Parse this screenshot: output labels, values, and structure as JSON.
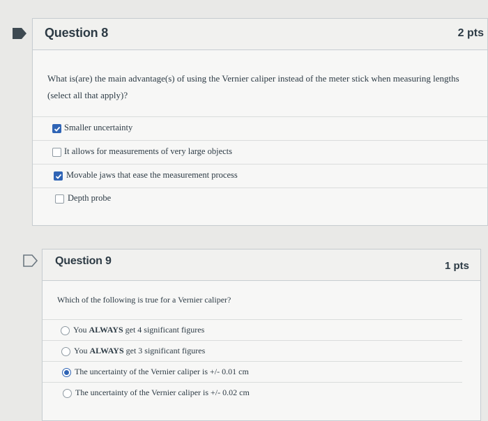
{
  "question8": {
    "title": "Question 8",
    "points": "2 pts",
    "text": "What is(are) the main advantage(s) of using the Vernier caliper instead of the meter stick when measuring lengths (select all that apply)?",
    "answers": [
      {
        "label": "Smaller uncertainty",
        "checked": true
      },
      {
        "label": "It allows for measurements of very large objects",
        "checked": false
      },
      {
        "label": "Movable jaws that ease the measurement process",
        "checked": true
      },
      {
        "label": "Depth probe",
        "checked": false
      }
    ]
  },
  "question9": {
    "title": "Question 9",
    "points": "1 pts",
    "text": "Which of the following is true for a Vernier caliper?",
    "answers": [
      {
        "prefix": "You ",
        "bold": "ALWAYS",
        "suffix": " get 4 significant figures",
        "selected": false
      },
      {
        "prefix": "You ",
        "bold": "ALWAYS",
        "suffix": " get 3 significant figures",
        "selected": false
      },
      {
        "prefix": "The uncertainty of the Vernier caliper is +/- 0.01 cm",
        "bold": "",
        "suffix": "",
        "selected": true
      },
      {
        "prefix": "The uncertainty of the Vernier caliper is +/- 0.02 cm",
        "bold": "",
        "suffix": "",
        "selected": false
      }
    ]
  },
  "colors": {
    "accent": "#2f64b5",
    "flag_filled": "#3e4a52"
  },
  "icons": {
    "q8_flag": "flag-filled-icon",
    "q9_flag": "flag-outline-icon"
  }
}
